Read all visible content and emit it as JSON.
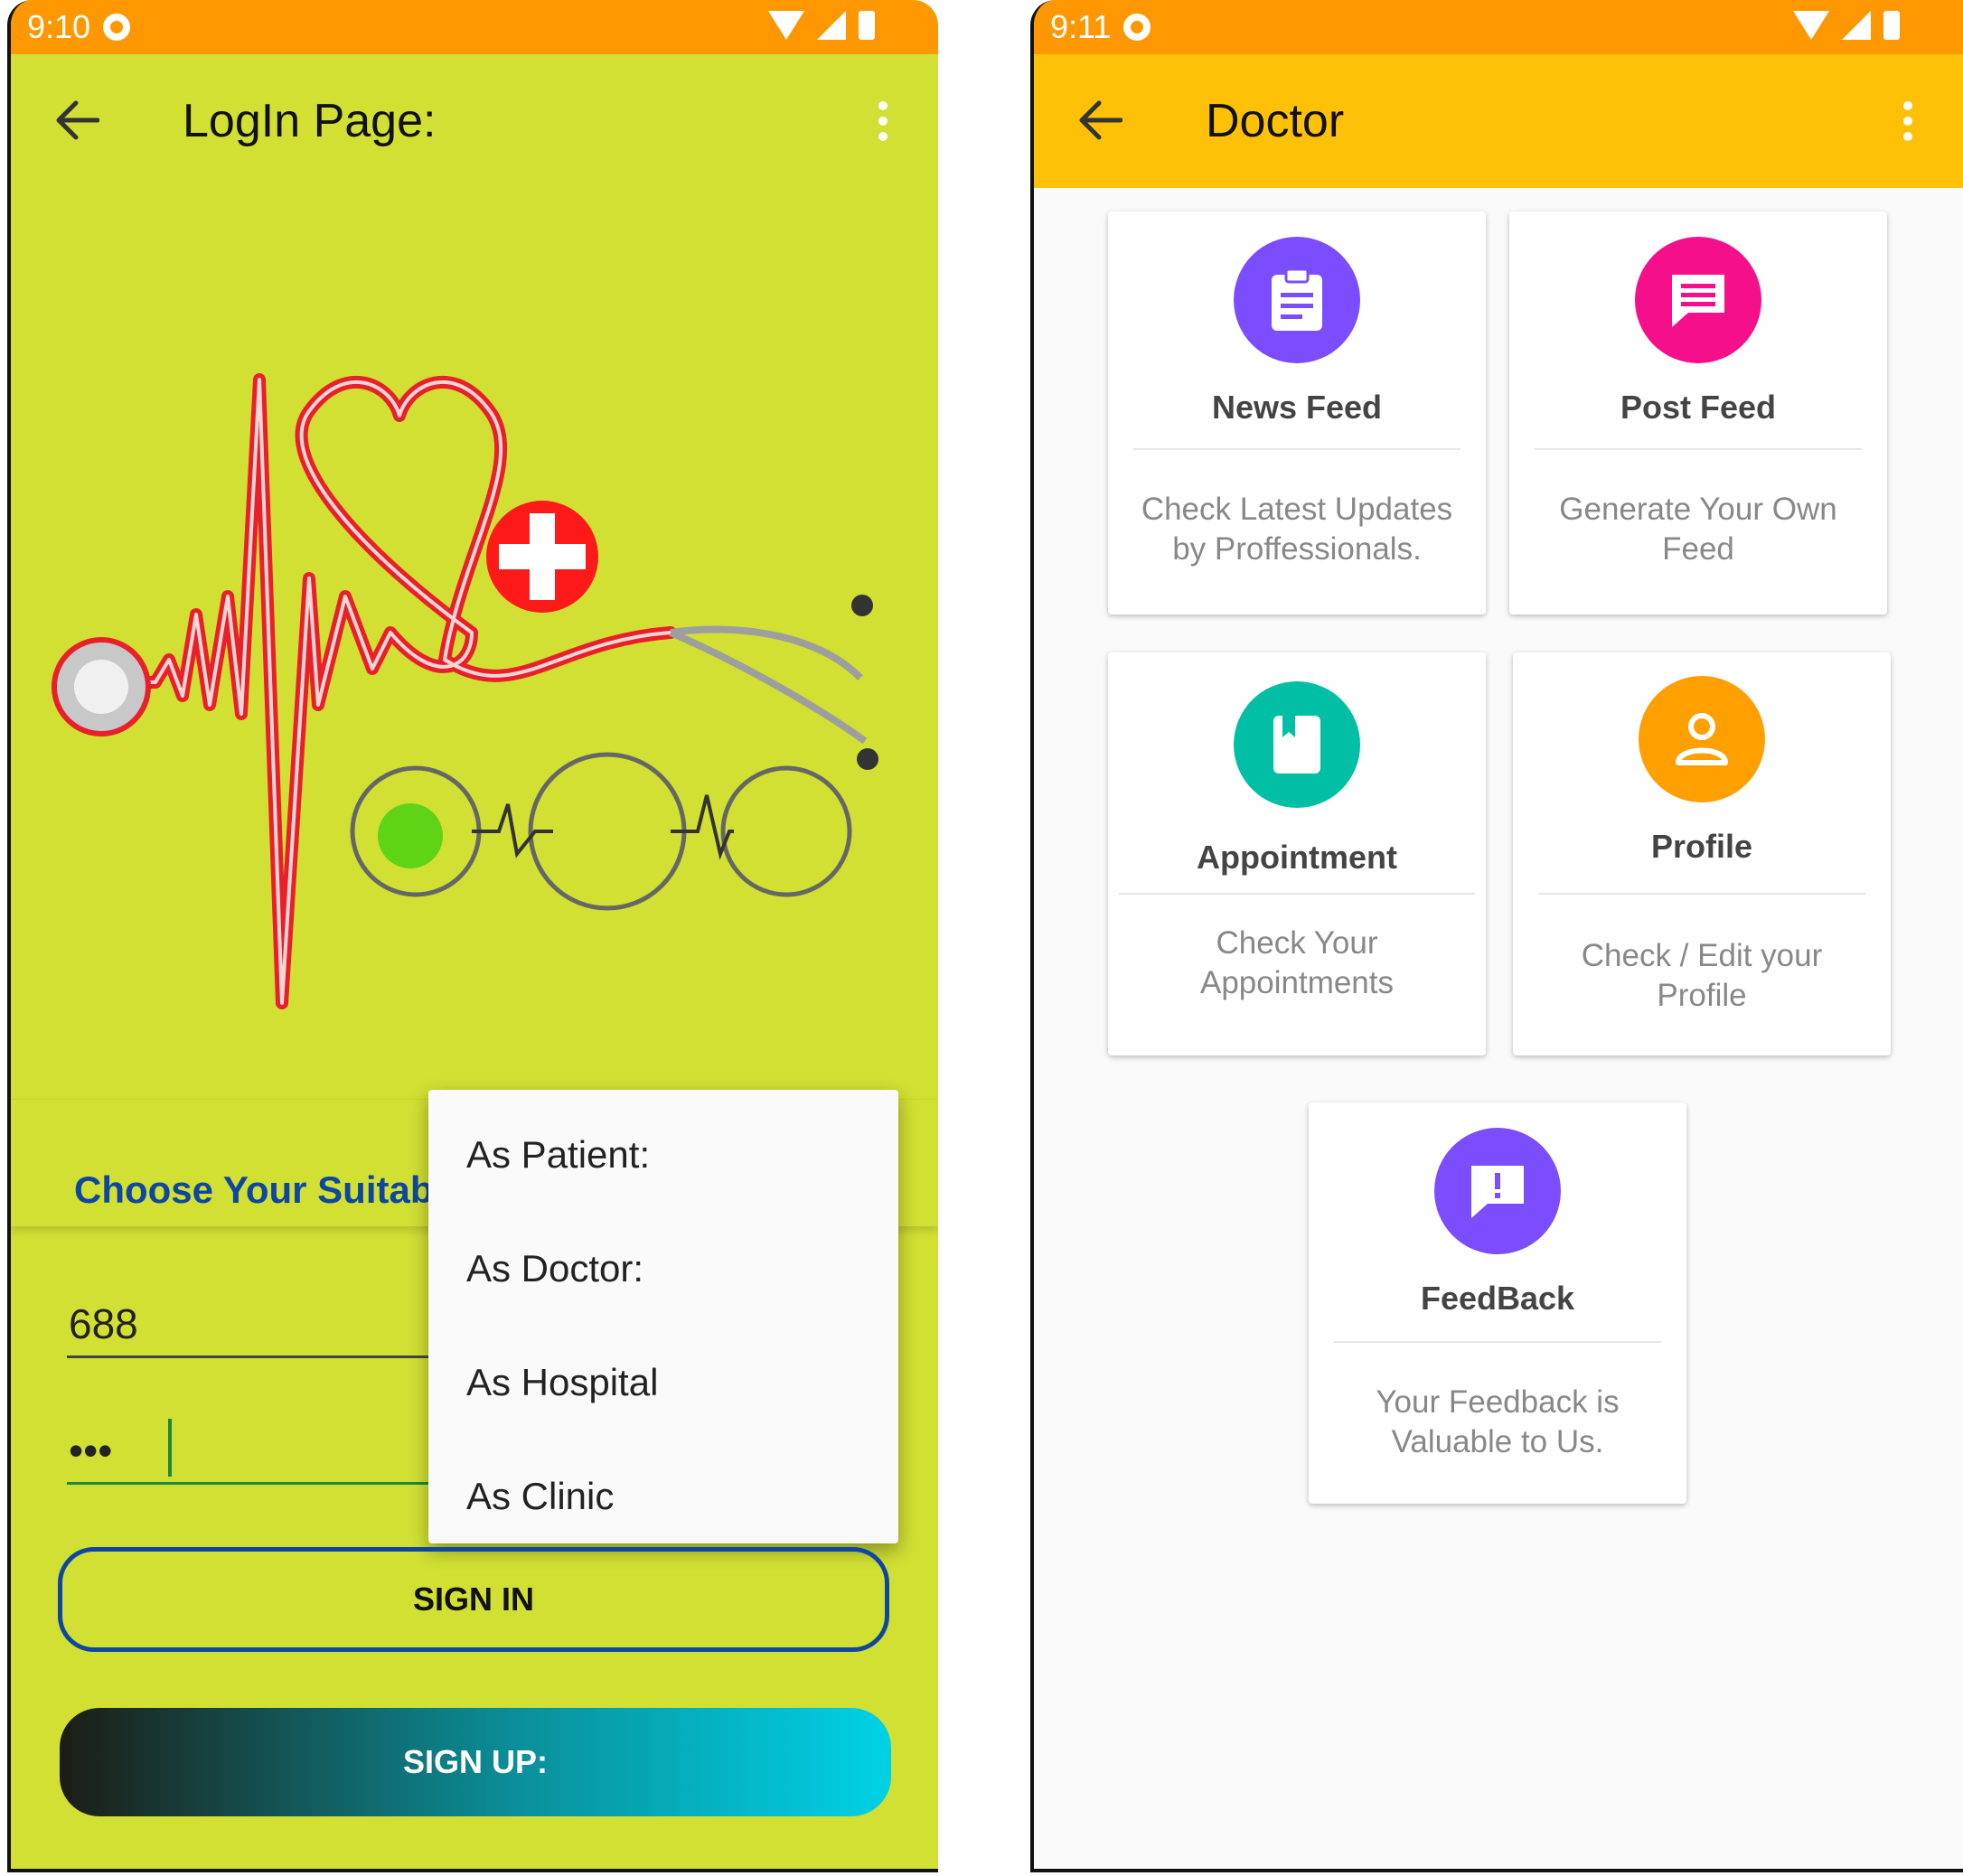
{
  "left_screen": {
    "status_time": "9:10",
    "title": "LogIn Page:",
    "choose_label": "Choose Your Suitabl",
    "username_value": "688",
    "password_value": "•••",
    "dropdown_options": [
      "As Patient:",
      "As Doctor:",
      "As Hospital",
      "As Clinic"
    ],
    "signin_label": "SIGN IN",
    "signup_label": "SIGN UP:"
  },
  "right_screen": {
    "status_time": "9:11",
    "title": "Doctor",
    "cards": [
      {
        "title": "News Feed",
        "desc_line1": "Check Latest Updates",
        "desc_line2": "by Proffessionals.",
        "icon": "clipboard-icon",
        "color": "#7c4dff"
      },
      {
        "title": "Post Feed",
        "desc_line1": "Generate Your Own",
        "desc_line2": "Feed",
        "icon": "message-icon",
        "color": "#f50f8a"
      },
      {
        "title": "Appointment",
        "desc_line1": "Check Your",
        "desc_line2": "Appointments",
        "icon": "book-icon",
        "color": "#00bfa5"
      },
      {
        "title": "Profile",
        "desc_line1": "Check / Edit your",
        "desc_line2": "Profile",
        "icon": "person-icon",
        "color": "#ffa000"
      },
      {
        "title": "FeedBack",
        "desc_line1": "Your Feedback is",
        "desc_line2": "Valuable to Us.",
        "icon": "feedback-icon",
        "color": "#7c4dff"
      }
    ]
  },
  "colors": {
    "status_bar": "#ff9800",
    "left_background": "#d1e033",
    "right_appbar": "#ffc107",
    "accent_blue": "#0d47a1"
  }
}
